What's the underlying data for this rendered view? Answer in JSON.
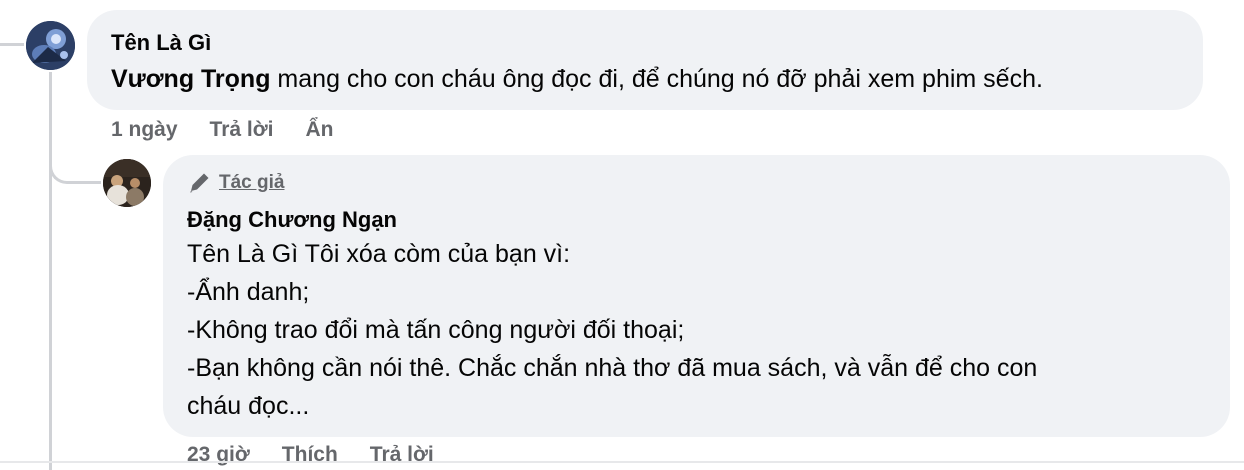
{
  "comment": {
    "author": "Tên Là Gì",
    "mention": "Vương Trọng",
    "text": " mang cho con cháu ông đọc đi, để chúng nó đỡ phải xem phim sếch.",
    "time": "1 ngày",
    "reply_label": "Trả lời",
    "hide_label": "Ẩn"
  },
  "reply": {
    "badge": "Tác giả",
    "badge_icon": "pencil-icon",
    "author": "Đặng Chương Ngạn",
    "lines": [
      "Tên Là Gì Tôi xóa còm của bạn vì:",
      "-Ẩnh danh;",
      "-Không trao đổi mà tấn công người đối thoại;",
      "-Bạn không cần nói thê. Chắc chắn nhà thơ đã mua sách, và vẫn để cho con",
      "cháu đọc..."
    ],
    "time": "23 giờ",
    "like_label": "Thích",
    "reply_label": "Trả lời"
  }
}
